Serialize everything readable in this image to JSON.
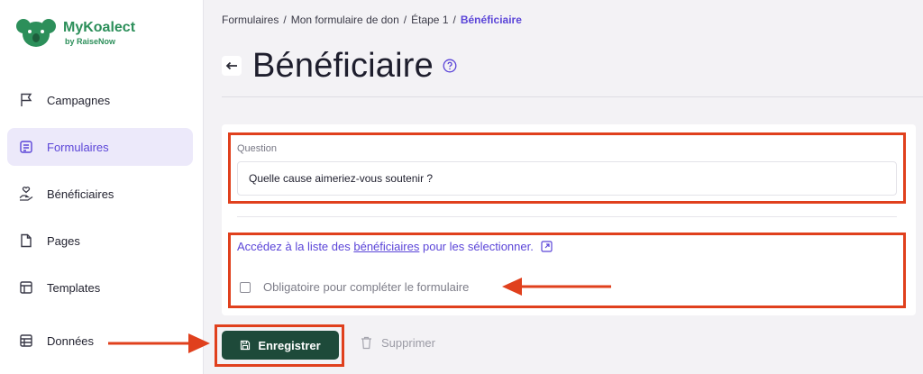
{
  "app": {
    "name": "MyKoalect",
    "subtitle": "by RaiseNow",
    "brand_color": "#2c8f5a"
  },
  "sidebar": {
    "items": [
      {
        "label": "Campagnes",
        "icon": "flag-icon",
        "active": false
      },
      {
        "label": "Formulaires",
        "icon": "form-icon",
        "active": true
      },
      {
        "label": "Bénéficiaires",
        "icon": "hand-heart-icon",
        "active": false
      },
      {
        "label": "Pages",
        "icon": "page-icon",
        "active": false
      },
      {
        "label": "Templates",
        "icon": "template-icon",
        "active": false
      },
      {
        "label": "Données",
        "icon": "table-icon",
        "active": false
      }
    ]
  },
  "breadcrumb": {
    "items": [
      {
        "label": "Formulaires",
        "sep": "/"
      },
      {
        "label": "Mon formulaire de don",
        "sep": "/"
      },
      {
        "label": "Étape 1",
        "sep": "/"
      }
    ],
    "current": "Bénéficiaire"
  },
  "page": {
    "title": "Bénéficiaire",
    "accent": "#5b45d8"
  },
  "form": {
    "question_label": "Question",
    "question_value": "Quelle cause aimeriez-vous soutenir ?",
    "link_prefix": "Accédez à la liste des",
    "link_text": "bénéficiaires",
    "link_suffix": "pour les sélectionner.",
    "checkbox_label": "Obligatoire pour compléter le formulaire",
    "checkbox_checked": false
  },
  "actions": {
    "save_label": "Enregistrer",
    "delete_label": "Supprimer",
    "save_color": "#1e4a3a"
  },
  "annotations": {
    "highlight_color": "#e0401d"
  }
}
